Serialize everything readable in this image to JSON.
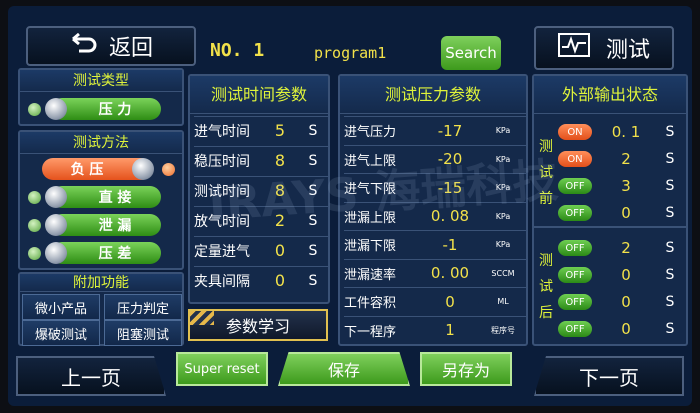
{
  "header": {
    "back_label": "返回",
    "program_no": "NO. 1",
    "program_name": "program1",
    "search_label": "Search",
    "test_label": "测试"
  },
  "test_type": {
    "title": "测试类型",
    "option": "压 力"
  },
  "test_method": {
    "title": "测试方法",
    "options": [
      {
        "label": "负 压",
        "active": true
      },
      {
        "label": "直 接",
        "active": false
      },
      {
        "label": "泄 漏",
        "active": false
      },
      {
        "label": "压 差",
        "active": false
      }
    ]
  },
  "extra": {
    "title": "附加功能",
    "buttons": [
      "微小产品",
      "压力判定",
      "爆破测试",
      "阻塞测试"
    ]
  },
  "time_params": {
    "title": "测试时间参数",
    "rows": [
      {
        "label": "进气时间",
        "value": "5",
        "unit": "S"
      },
      {
        "label": "稳压时间",
        "value": "8",
        "unit": "S"
      },
      {
        "label": "测试时间",
        "value": "8",
        "unit": "S"
      },
      {
        "label": "放气时间",
        "value": "2",
        "unit": "S"
      },
      {
        "label": "定量进气",
        "value": "0",
        "unit": "S"
      },
      {
        "label": "夹具间隔",
        "value": "0",
        "unit": "S"
      }
    ],
    "learn_label": "参数学习"
  },
  "pressure_params": {
    "title": "测试压力参数",
    "rows": [
      {
        "label": "进气压力",
        "value": "-17",
        "unit": "KPa"
      },
      {
        "label": "进气上限",
        "value": "-20",
        "unit": "KPa"
      },
      {
        "label": "进气下限",
        "value": "-15",
        "unit": "KPa"
      },
      {
        "label": "泄漏上限",
        "value": "0. 08",
        "unit": "KPa"
      },
      {
        "label": "泄漏下限",
        "value": "-1",
        "unit": "KPa"
      },
      {
        "label": "泄漏速率",
        "value": "0. 00",
        "unit": "SCCM"
      },
      {
        "label": "工件容积",
        "value": "0",
        "unit": "ML"
      },
      {
        "label": "下一程序",
        "value": "1",
        "unit": "程序号"
      }
    ]
  },
  "outputs": {
    "title": "外部输出状态",
    "before_label": "测试前",
    "after_label": "测试后",
    "before": [
      {
        "state": "ON",
        "value": "0. 1",
        "unit": "S"
      },
      {
        "state": "ON",
        "value": "2",
        "unit": "S"
      },
      {
        "state": "OFF",
        "value": "3",
        "unit": "S"
      },
      {
        "state": "OFF",
        "value": "0",
        "unit": "S"
      }
    ],
    "after": [
      {
        "state": "OFF",
        "value": "2",
        "unit": "S"
      },
      {
        "state": "OFF",
        "value": "0",
        "unit": "S"
      },
      {
        "state": "OFF",
        "value": "0",
        "unit": "S"
      },
      {
        "state": "OFF",
        "value": "0",
        "unit": "S"
      }
    ]
  },
  "footer": {
    "prev_label": "上一页",
    "reset_label": "Super reset",
    "save_label": "保存",
    "save_as_label": "另存为",
    "next_label": "下一页"
  },
  "watermark": "IRAYS 海瑞科技",
  "colors": {
    "accent_yellow": "#f2e14a",
    "green": "#3d9a1c",
    "orange": "#e5521c",
    "panel": "#14294a"
  }
}
